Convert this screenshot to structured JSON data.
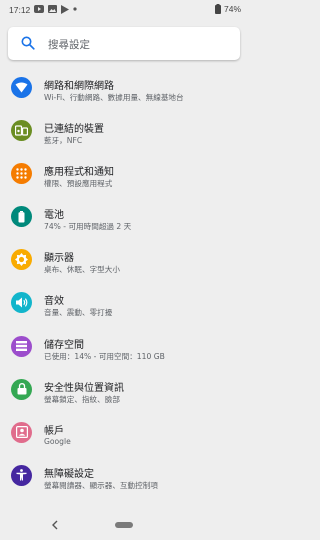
{
  "status_bar": {
    "time": "17:12",
    "battery": "74%",
    "icons": [
      "youtube-icon",
      "gallery-icon",
      "play-store-icon",
      "dot-icon"
    ]
  },
  "search": {
    "placeholder": "搜尋設定"
  },
  "settings": [
    {
      "id": "network",
      "title": "網路和網際網路",
      "subtitle": "Wi-Fi、行動網路、數據用量、無線基地台",
      "icon": "wifi-icon",
      "color": "#1a73e8"
    },
    {
      "id": "connected-devices",
      "title": "已連結的裝置",
      "subtitle": "藍牙，NFC",
      "icon": "devices-icon",
      "color": "#6b8e23"
    },
    {
      "id": "apps",
      "title": "應用程式和通知",
      "subtitle": "權限、預設應用程式",
      "icon": "apps-icon",
      "color": "#f57c00"
    },
    {
      "id": "battery",
      "title": "電池",
      "subtitle": "74% - 可用時間超過 2 天",
      "icon": "battery-icon",
      "color": "#00897b"
    },
    {
      "id": "display",
      "title": "顯示器",
      "subtitle": "桌布、休眠、字型大小",
      "icon": "brightness-icon",
      "color": "#f9ab00"
    },
    {
      "id": "sound",
      "title": "音效",
      "subtitle": "音量、震動、零打擾",
      "icon": "volume-icon",
      "color": "#12b5cb"
    },
    {
      "id": "storage",
      "title": "儲存空間",
      "subtitle": "已使用：14% - 可用空間：110 GB",
      "icon": "storage-icon",
      "color": "#9c4dcc"
    },
    {
      "id": "security",
      "title": "安全性與位置資訊",
      "subtitle": "螢幕鎖定、指紋、臉部",
      "icon": "lock-icon",
      "color": "#34a853"
    },
    {
      "id": "accounts",
      "title": "帳戶",
      "subtitle": "Google",
      "icon": "account-icon",
      "color": "#e06c8c"
    },
    {
      "id": "accessibility",
      "title": "無障礙設定",
      "subtitle": "螢幕閱讀器、顯示器、互動控制項",
      "icon": "accessibility-icon",
      "color": "#4527a0"
    }
  ]
}
